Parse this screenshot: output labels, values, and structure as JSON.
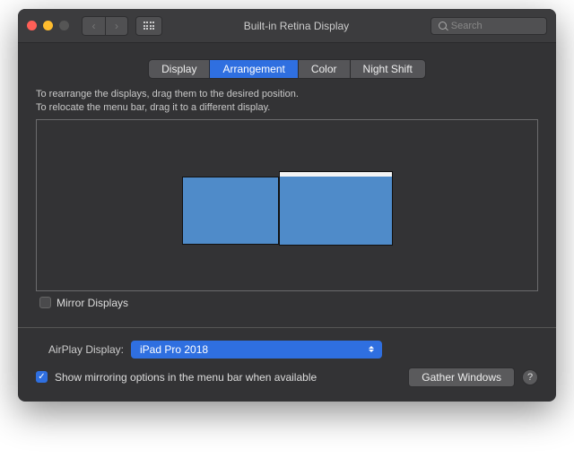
{
  "window": {
    "title": "Built-in Retina Display",
    "search_placeholder": "Search"
  },
  "tabs": {
    "display": "Display",
    "arrangement": "Arrangement",
    "color": "Color",
    "night_shift": "Night Shift",
    "active": "arrangement"
  },
  "arrangement": {
    "help_line1": "To rearrange the displays, drag them to the desired position.",
    "help_line2": "To relocate the menu bar, drag it to a different display.",
    "mirror_label": "Mirror Displays",
    "mirror_checked": false
  },
  "airplay": {
    "label": "AirPlay Display:",
    "selected": "iPad Pro 2018"
  },
  "mirroring": {
    "label": "Show mirroring options in the menu bar when available",
    "checked": true
  },
  "buttons": {
    "gather_windows": "Gather Windows"
  },
  "help_badge": "?"
}
